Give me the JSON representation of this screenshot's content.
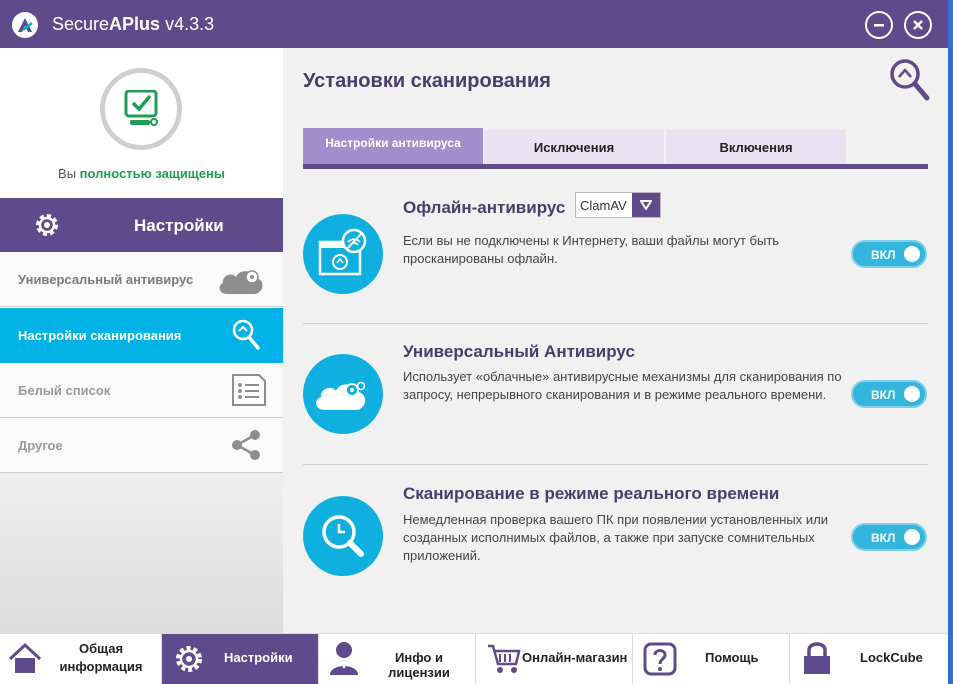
{
  "titlebar": {
    "app_name": "Secure",
    "app_name_bold": "APlus",
    "version": "v4.3.3"
  },
  "sidebar": {
    "status_prefix": "Вы ",
    "status_highlight": "полностью защищены",
    "settings_label": "Настройки",
    "items": [
      {
        "label": "Универсальный антивирус",
        "icon": "cloud-icon"
      },
      {
        "label": "Настройки сканирования",
        "icon": "search-icon"
      },
      {
        "label": "Белый список",
        "icon": "list-icon"
      },
      {
        "label": "Другое",
        "icon": "share-icon"
      }
    ]
  },
  "main": {
    "title": "Установки сканирования",
    "tabs": [
      "Настройки антивируса",
      "Исключения",
      "Включения"
    ],
    "sections": [
      {
        "title": "Офлайн-антивирус",
        "select_value": "ClamAV",
        "desc": "Если вы не подключены к Интернету, ваши файлы могут быть просканированы офлайн.",
        "toggle": "ВКЛ"
      },
      {
        "title": "Универсальный Антивирус",
        "desc": "Использует «облачные» антивирусные механизмы для сканирования по запросу, непрерывного сканирования и в режиме реального времени.",
        "toggle": "ВКЛ"
      },
      {
        "title": "Сканирование в  режиме реального времени",
        "desc": "Немедленная проверка вашего ПК при появлении установленных или созданных исполнимых файлов, а также при запуске сомнительных приложений.",
        "toggle": "ВКЛ"
      }
    ]
  },
  "bottombar": {
    "items": [
      {
        "label": "Общая информация",
        "icon": "home-icon"
      },
      {
        "label": "Настройки",
        "icon": "gear-icon"
      },
      {
        "label": "Инфо и лицензии",
        "icon": "user-icon"
      },
      {
        "label": "Онлайн-магазин",
        "icon": "cart-icon"
      },
      {
        "label": "Помощь",
        "icon": "help-icon"
      },
      {
        "label": "LockCube",
        "icon": "lock-icon"
      }
    ]
  },
  "colors": {
    "purple": "#5f4b8b",
    "cyan": "#00b2e6",
    "tab_active": "#a08fcc",
    "green": "#1f9d55"
  }
}
